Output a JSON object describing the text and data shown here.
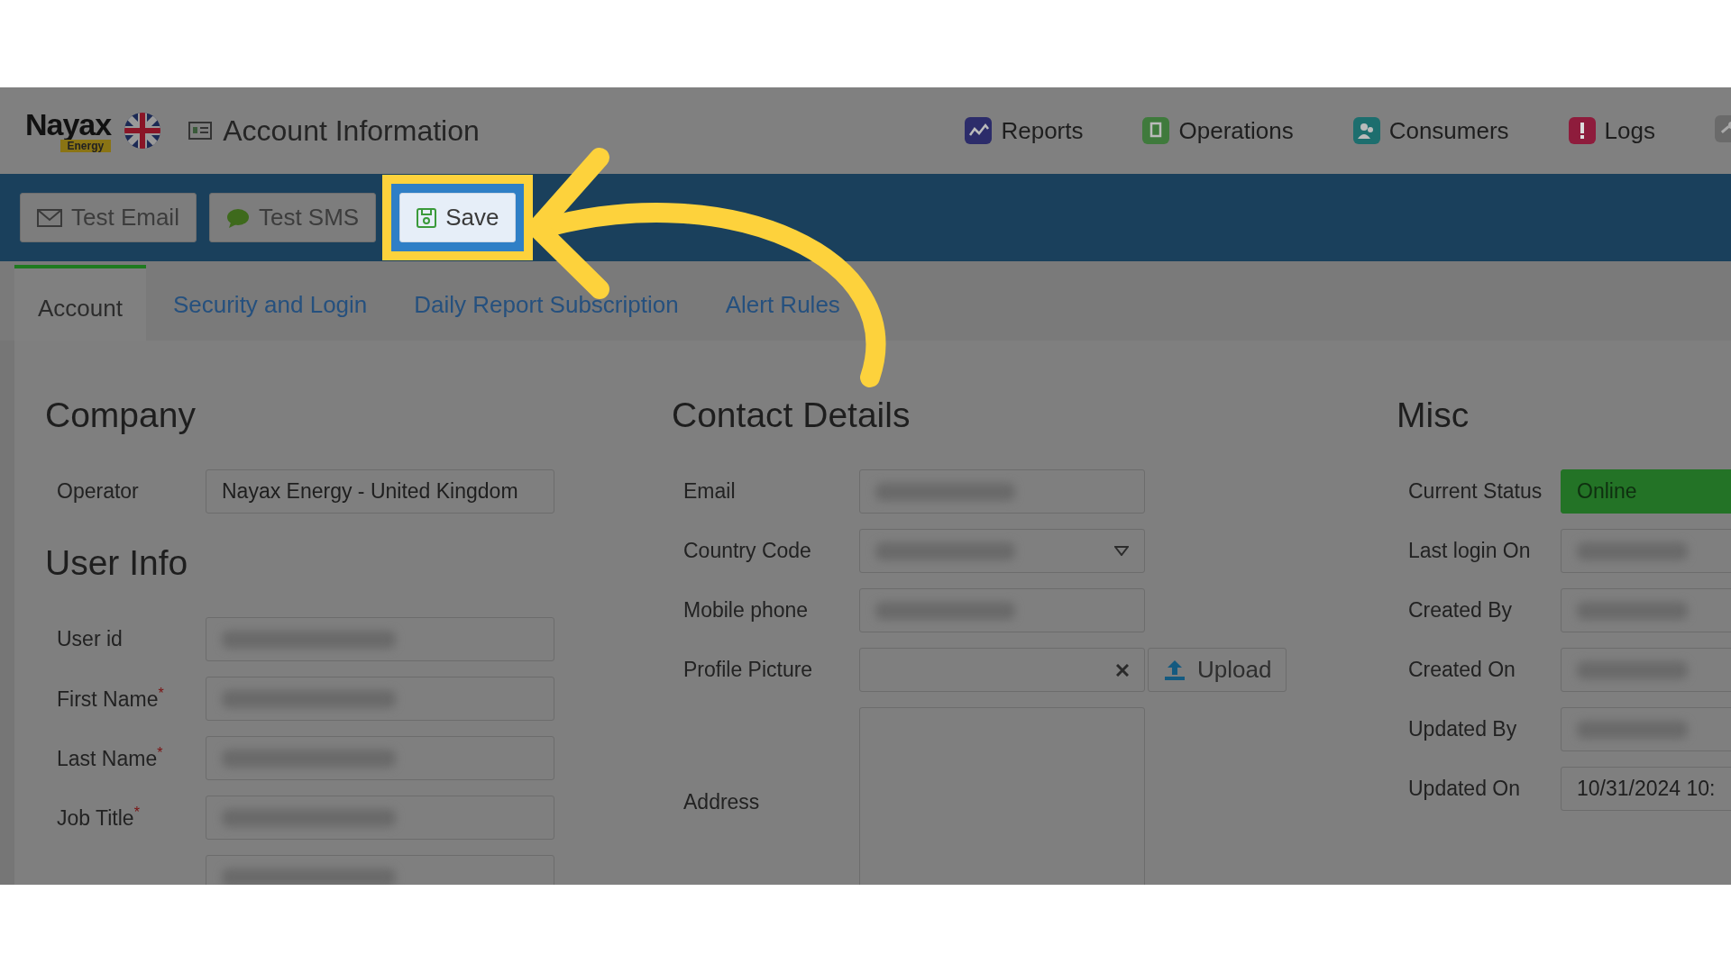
{
  "header": {
    "logo": {
      "word": "Nayax",
      "sub": "Energy"
    },
    "page_title": "Account Information",
    "nav": [
      {
        "label": "Reports",
        "kind": "chart",
        "color": "#2c2c6a"
      },
      {
        "label": "Operations",
        "kind": "machine",
        "color": "#3f7a3c"
      },
      {
        "label": "Consumers",
        "kind": "people",
        "color": "#1d6e6e"
      },
      {
        "label": "Logs",
        "kind": "alert",
        "color": "#8e1c3c"
      },
      {
        "kind": "key",
        "color": "#6a6a6a"
      }
    ]
  },
  "toolbar": {
    "buttons": [
      {
        "label": "Test Email",
        "kind": "email",
        "highlighted": false
      },
      {
        "label": "Test SMS",
        "kind": "sms",
        "highlighted": false
      },
      {
        "label": "Save",
        "kind": "save",
        "highlighted": true
      }
    ]
  },
  "tabs": [
    {
      "label": "Account",
      "selected": true
    },
    {
      "label": "Security and Login",
      "selected": false
    },
    {
      "label": "Daily Report Subscription",
      "selected": false
    },
    {
      "label": "Alert Rules",
      "selected": false
    }
  ],
  "company": {
    "title": "Company",
    "fields": [
      {
        "label": "Operator",
        "kind": "text",
        "value": "Nayax Energy - United Kingdom"
      }
    ]
  },
  "user_info": {
    "title": "User Info",
    "fields": [
      {
        "label": "User id",
        "kind": "text",
        "redacted": true
      },
      {
        "label": "First Name$^{*}$",
        "kind": "text",
        "redacted": true
      },
      {
        "label": "Last Name$^{*}$",
        "kind": "text",
        "redacted": true
      },
      {
        "label": "Job Title$^{*}$",
        "kind": "text",
        "redacted": true
      },
      {
        "kind": "text",
        "redacted": true
      }
    ]
  },
  "contact": {
    "title": "Contact Details",
    "fields": [
      {
        "label": "Email",
        "kind": "text",
        "redacted": true
      },
      {
        "label": "Country Code",
        "kind": "select",
        "redacted": true
      },
      {
        "label": "Mobile phone",
        "kind": "text",
        "redacted": true
      },
      {
        "label": "Profile Picture",
        "kind": "file",
        "button": "Upload"
      },
      {
        "label": "Address",
        "kind": "textarea"
      }
    ]
  },
  "misc": {
    "title": "Misc",
    "fields": [
      {
        "label": "Current Status",
        "kind": "status",
        "value": "Online"
      },
      {
        "label": "Last login On",
        "kind": "text",
        "redacted": true
      },
      {
        "label": "Created By",
        "kind": "text",
        "redacted": true
      },
      {
        "label": "Created On",
        "kind": "text",
        "redacted": true
      },
      {
        "label": "Updated By",
        "kind": "text",
        "redacted": true
      },
      {
        "label": "Updated On",
        "kind": "text",
        "value": "10/31/2024 10:"
      }
    ]
  }
}
